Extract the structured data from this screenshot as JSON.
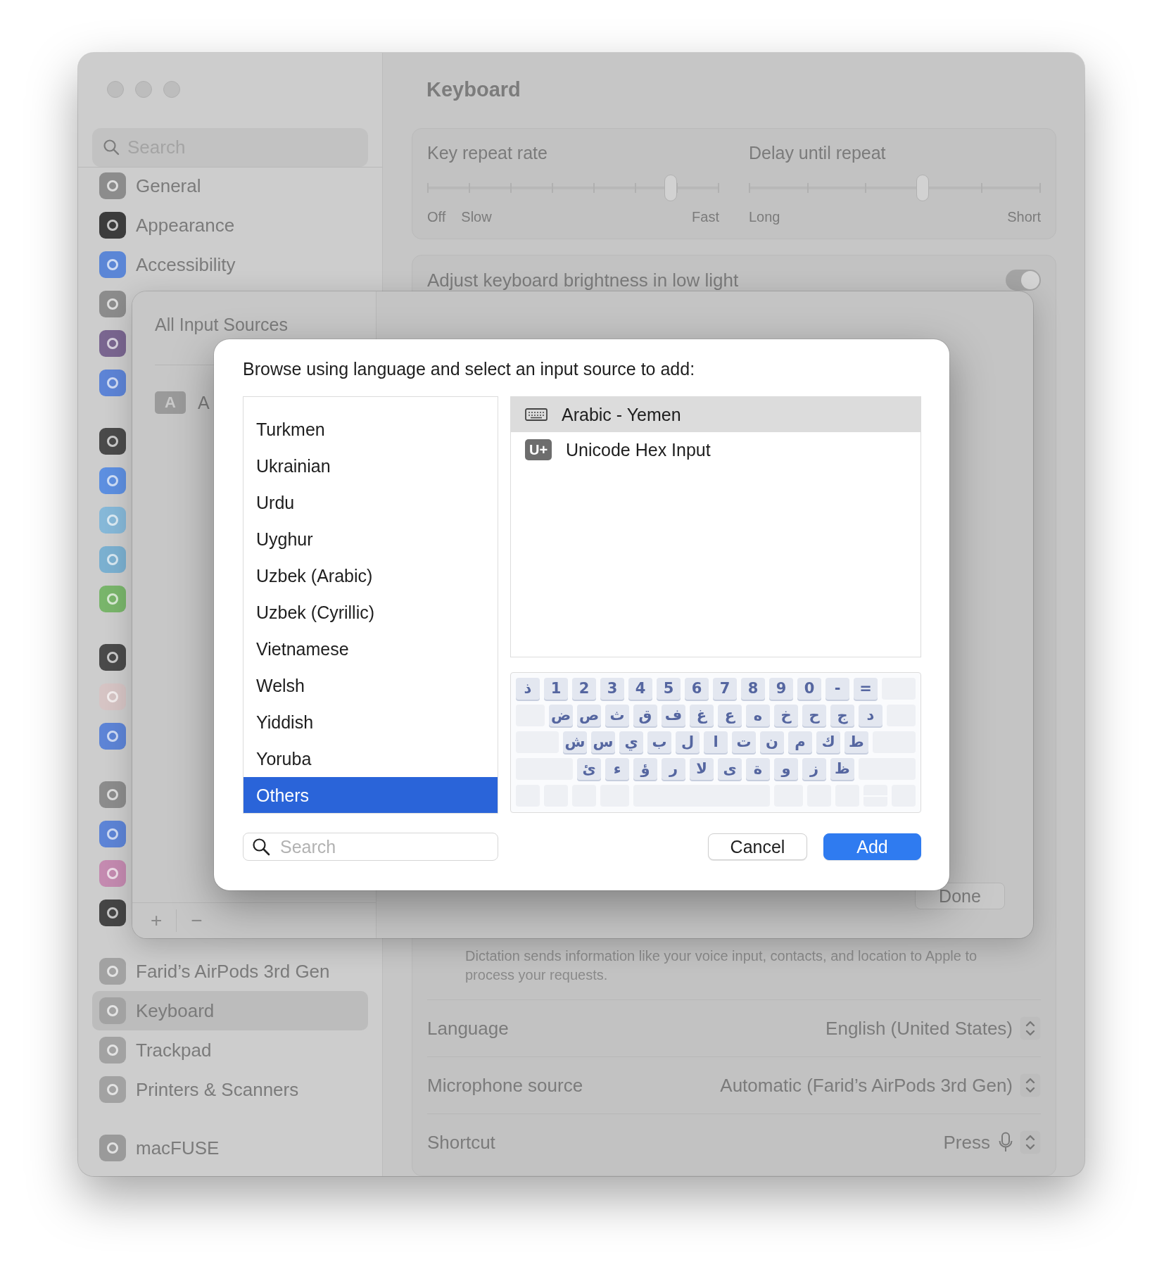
{
  "sidebar": {
    "search": {
      "placeholder": "Search"
    },
    "groups": [
      [
        {
          "label": "General",
          "color": "#8c8c8c",
          "selected": false
        },
        {
          "label": "Appearance",
          "color": "#3c3c3c",
          "selected": false
        },
        {
          "label": "Accessibility",
          "color": "#5b86d6",
          "selected": false
        },
        {
          "color": "#8c8c8c"
        },
        {
          "color": "#7a6690"
        },
        {
          "color": "#5d84d6"
        }
      ],
      [
        {
          "color": "#4a4a4a"
        },
        {
          "color": "#5d8fe0"
        },
        {
          "color": "#86b8d8"
        },
        {
          "color": "#7bb0d0"
        },
        {
          "color": "#79b56b"
        }
      ],
      [
        {
          "color": "#4a4a4a"
        },
        {
          "color": "#d6c4c4"
        },
        {
          "color": "#5d84d6"
        }
      ],
      [
        {
          "color": "#8c8c8c"
        },
        {
          "color": "#5d84d6"
        },
        {
          "color": "#c48ab0"
        },
        {
          "color": "#454545"
        }
      ],
      [
        {
          "label": "Farid’s AirPods 3rd Gen",
          "color": "#a2a2a2",
          "selected": false
        },
        {
          "label": "Keyboard",
          "color": "#a2a2a2",
          "selected": true
        },
        {
          "label": "Trackpad",
          "color": "#a2a2a2",
          "selected": false
        },
        {
          "label": "Printers & Scanners",
          "color": "#a2a2a2",
          "selected": false
        }
      ],
      [
        {
          "label": "macFUSE",
          "color": "#9a9a9a",
          "selected": false
        }
      ]
    ]
  },
  "content": {
    "title": "Keyboard",
    "sliders": [
      {
        "label": "Key repeat rate",
        "level": 0.85,
        "marks": [
          "Off",
          "Slow",
          "Fast"
        ]
      },
      {
        "label": "Delay until repeat",
        "level": 0.6,
        "marks": [
          "Long",
          "Short"
        ]
      }
    ],
    "brightness": {
      "label": "Adjust keyboard brightness in low light",
      "on": true
    },
    "dictation_note": "Dictation sends information like your voice input, contacts, and location to Apple to process your requests.",
    "rows": [
      {
        "label": "Language",
        "value": "English (United States)",
        "kind": "popup"
      },
      {
        "label": "Microphone source",
        "value": "Automatic (Farid’s AirPods 3rd Gen)",
        "kind": "popup"
      },
      {
        "label": "Shortcut",
        "value": "Press",
        "kind": "mic"
      }
    ]
  },
  "input_sources_sheet": {
    "title": "All Input Sources",
    "sources": [
      {
        "badge": "A",
        "label": "A"
      }
    ],
    "add": "+",
    "remove": "−",
    "done": "Done"
  },
  "add_dialog": {
    "prompt": "Browse using language and select an input source to add:",
    "languages": [
      {
        "label": "Turkmen",
        "selected": false
      },
      {
        "label": "Ukrainian",
        "selected": false
      },
      {
        "label": "Urdu",
        "selected": false
      },
      {
        "label": "Uyghur",
        "selected": false
      },
      {
        "label": "Uzbek (Arabic)",
        "selected": false
      },
      {
        "label": "Uzbek (Cyrillic)",
        "selected": false
      },
      {
        "label": "Vietnamese",
        "selected": false
      },
      {
        "label": "Welsh",
        "selected": false
      },
      {
        "label": "Yiddish",
        "selected": false
      },
      {
        "label": "Yoruba",
        "selected": false
      },
      {
        "label": "Others",
        "selected": true
      }
    ],
    "sources": [
      {
        "label": "Arabic - Yemen",
        "kind": "keyboard",
        "selected": true
      },
      {
        "label": "Unicode Hex Input",
        "kind": "unicode",
        "badge": "U+",
        "selected": false
      }
    ],
    "keyboard_preview": {
      "rows": [
        {
          "kind": "ltr",
          "keys": [
            {
              "kind": "key",
              "label": "ذ"
            },
            {
              "kind": "key",
              "label": "1"
            },
            {
              "kind": "key",
              "label": "2"
            },
            {
              "kind": "key",
              "label": "3"
            },
            {
              "kind": "key",
              "label": "4"
            },
            {
              "kind": "key",
              "label": "5"
            },
            {
              "kind": "key",
              "label": "6"
            },
            {
              "kind": "key",
              "label": "7"
            },
            {
              "kind": "key",
              "label": "8"
            },
            {
              "kind": "key",
              "label": "9"
            },
            {
              "kind": "key",
              "label": "0"
            },
            {
              "kind": "key",
              "label": "-"
            },
            {
              "kind": "key",
              "label": "="
            },
            {
              "kind": "fill"
            }
          ]
        },
        {
          "kind": "rtl",
          "keys": [
            {
              "kind": "fill"
            },
            {
              "kind": "key",
              "label": "د"
            },
            {
              "kind": "key",
              "label": "ج"
            },
            {
              "kind": "key",
              "label": "ح"
            },
            {
              "kind": "key",
              "label": "خ"
            },
            {
              "kind": "key",
              "label": "ه"
            },
            {
              "kind": "key",
              "label": "ع"
            },
            {
              "kind": "key",
              "label": "غ"
            },
            {
              "kind": "key",
              "label": "ف"
            },
            {
              "kind": "key",
              "label": "ق"
            },
            {
              "kind": "key",
              "label": "ث"
            },
            {
              "kind": "key",
              "label": "ص"
            },
            {
              "kind": "key",
              "label": "ض"
            },
            {
              "kind": "fill"
            }
          ]
        },
        {
          "kind": "rtl",
          "keys": [
            {
              "kind": "fill"
            },
            {
              "kind": "key",
              "label": "ط"
            },
            {
              "kind": "key",
              "label": "ك"
            },
            {
              "kind": "key",
              "label": "م"
            },
            {
              "kind": "key",
              "label": "ن"
            },
            {
              "kind": "key",
              "label": "ت"
            },
            {
              "kind": "key",
              "label": "ا"
            },
            {
              "kind": "key",
              "label": "ل"
            },
            {
              "kind": "key",
              "label": "ب"
            },
            {
              "kind": "key",
              "label": "ي"
            },
            {
              "kind": "key",
              "label": "س"
            },
            {
              "kind": "key",
              "label": "ش"
            },
            {
              "kind": "fill"
            }
          ]
        },
        {
          "kind": "rtl",
          "keys": [
            {
              "kind": "fill"
            },
            {
              "kind": "key",
              "label": "ظ"
            },
            {
              "kind": "key",
              "label": "ز"
            },
            {
              "kind": "key",
              "label": "و"
            },
            {
              "kind": "key",
              "label": "ة"
            },
            {
              "kind": "key",
              "label": "ى"
            },
            {
              "kind": "key",
              "label": "لا"
            },
            {
              "kind": "key",
              "label": "ر"
            },
            {
              "kind": "key",
              "label": "ؤ"
            },
            {
              "kind": "key",
              "label": "ء"
            },
            {
              "kind": "key",
              "label": "ئ"
            },
            {
              "kind": "fill"
            }
          ]
        },
        {
          "kind": "ltr",
          "keys": [
            {
              "kind": "blank"
            },
            {
              "kind": "blank"
            },
            {
              "kind": "blank"
            },
            {
              "kind": "wide"
            },
            {
              "kind": "space"
            },
            {
              "kind": "wide"
            },
            {
              "kind": "blank"
            },
            {
              "kind": "blank"
            },
            {
              "kind": "arrows"
            },
            {
              "kind": "blank"
            }
          ]
        }
      ]
    },
    "search": {
      "placeholder": "Search"
    },
    "buttons": [
      {
        "label": "Cancel",
        "kind": "secondary"
      },
      {
        "label": "Add",
        "kind": "primary"
      }
    ]
  }
}
